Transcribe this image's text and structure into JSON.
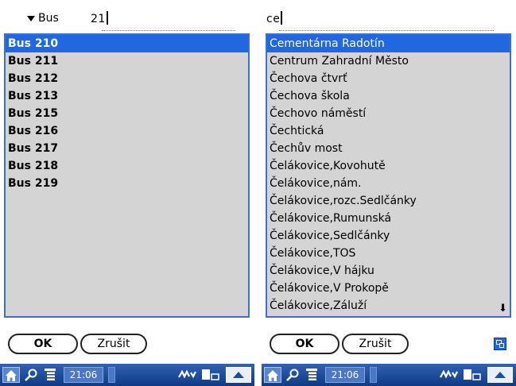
{
  "left": {
    "filter_label": "Bus",
    "search_value": "21",
    "items": [
      "Bus 210",
      "Bus 211",
      "Bus 212",
      "Bus 213",
      "Bus 215",
      "Bus 216",
      "Bus 217",
      "Bus 218",
      "Bus 219"
    ],
    "selected_index": 0,
    "ok_label": "OK",
    "cancel_label": "Zrušit",
    "time": "21:06"
  },
  "right": {
    "search_value": "ce",
    "items": [
      "Cementárna Radotín",
      "Centrum Zahradní Město",
      "Čechova čtvrť",
      "Čechova škola",
      "Čechovo náměstí",
      "Čechtická",
      "Čechův most",
      "Čelákovice,Kovohutě",
      "Čelákovice,nám.",
      "Čelákovice,rozc.Sedlčánky",
      "Čelákovice,Rumunská",
      "Čelákovice,Sedlčánky",
      "Čelákovice,TOS",
      "Čelákovice,V hájku",
      "Čelákovice,V Prokopě",
      "Čelákovice,Záluží"
    ],
    "selected_index": 0,
    "ok_label": "OK",
    "cancel_label": "Zrušit",
    "time": "21:06"
  },
  "icons": {
    "dropdown": "triangle-down-icon",
    "scroll_down": "arrow-down-icon",
    "window": "window-switch-icon",
    "home": "home-icon",
    "find": "find-icon",
    "menu": "menu-icon",
    "signal": "signal-icon",
    "graffiti": "graffiti-icon",
    "display": "display-icon",
    "input_area": "input-area-icon"
  },
  "colors": {
    "selection": "#2167e0",
    "list_background": "#d4d4d4",
    "taskbar": "#1f4f9e"
  }
}
